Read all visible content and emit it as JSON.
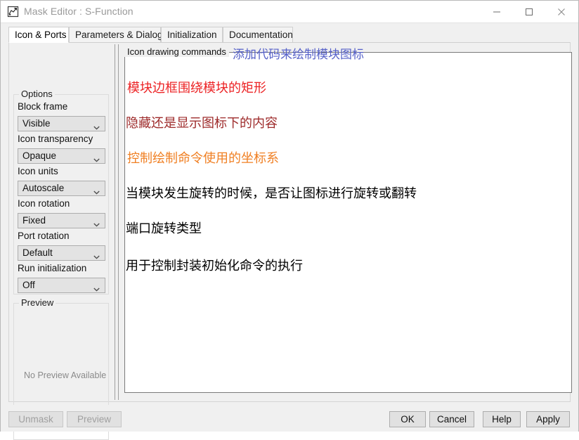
{
  "window": {
    "title": "Mask Editor : S-Function",
    "icon": "mask-editor-icon",
    "controls": {
      "minimize": "minimize-icon",
      "maximize": "maximize-icon",
      "close": "close-icon"
    }
  },
  "tabs": [
    {
      "label": "Icon & Ports",
      "active": true
    },
    {
      "label": "Parameters & Dialog",
      "active": false
    },
    {
      "label": "Initialization",
      "active": false
    },
    {
      "label": "Documentation",
      "active": false
    }
  ],
  "sidebar": {
    "options_group_label": "Options",
    "fields": [
      {
        "label": "Block frame",
        "value": "Visible"
      },
      {
        "label": "Icon transparency",
        "value": "Opaque"
      },
      {
        "label": "Icon units",
        "value": "Autoscale"
      },
      {
        "label": "Icon rotation",
        "value": "Fixed"
      },
      {
        "label": "Port rotation",
        "value": "Default"
      },
      {
        "label": "Run initialization",
        "value": "Off"
      }
    ],
    "preview_group_label": "Preview",
    "preview_empty_text": "No Preview Available"
  },
  "main": {
    "commands_label": "Icon drawing commands",
    "commands_note": "添加代码来绘制模块图标",
    "annotations": [
      {
        "text": "模块边框围绕模块的矩形",
        "color": "red"
      },
      {
        "text": "隐藏还是显示图标下的内容",
        "color": "maroon"
      },
      {
        "text": "控制绘制命令使用的坐标系",
        "color": "orange"
      },
      {
        "text": "当模块发生旋转的时候，是否让图标进行旋转或翻转",
        "color": "black"
      },
      {
        "text": " 端口旋转类型",
        "color": "black"
      },
      {
        "text": "用于控制封装初始化命令的执行",
        "color": "black"
      }
    ]
  },
  "footer": {
    "unmask": "Unmask",
    "preview": "Preview",
    "ok": "OK",
    "cancel": "Cancel",
    "help": "Help",
    "apply": "Apply"
  },
  "colors": {
    "note_blue": "#5560c8",
    "annot_red": "#ec2224",
    "annot_maroon": "#9e2b2b",
    "annot_orange": "#f08024"
  }
}
